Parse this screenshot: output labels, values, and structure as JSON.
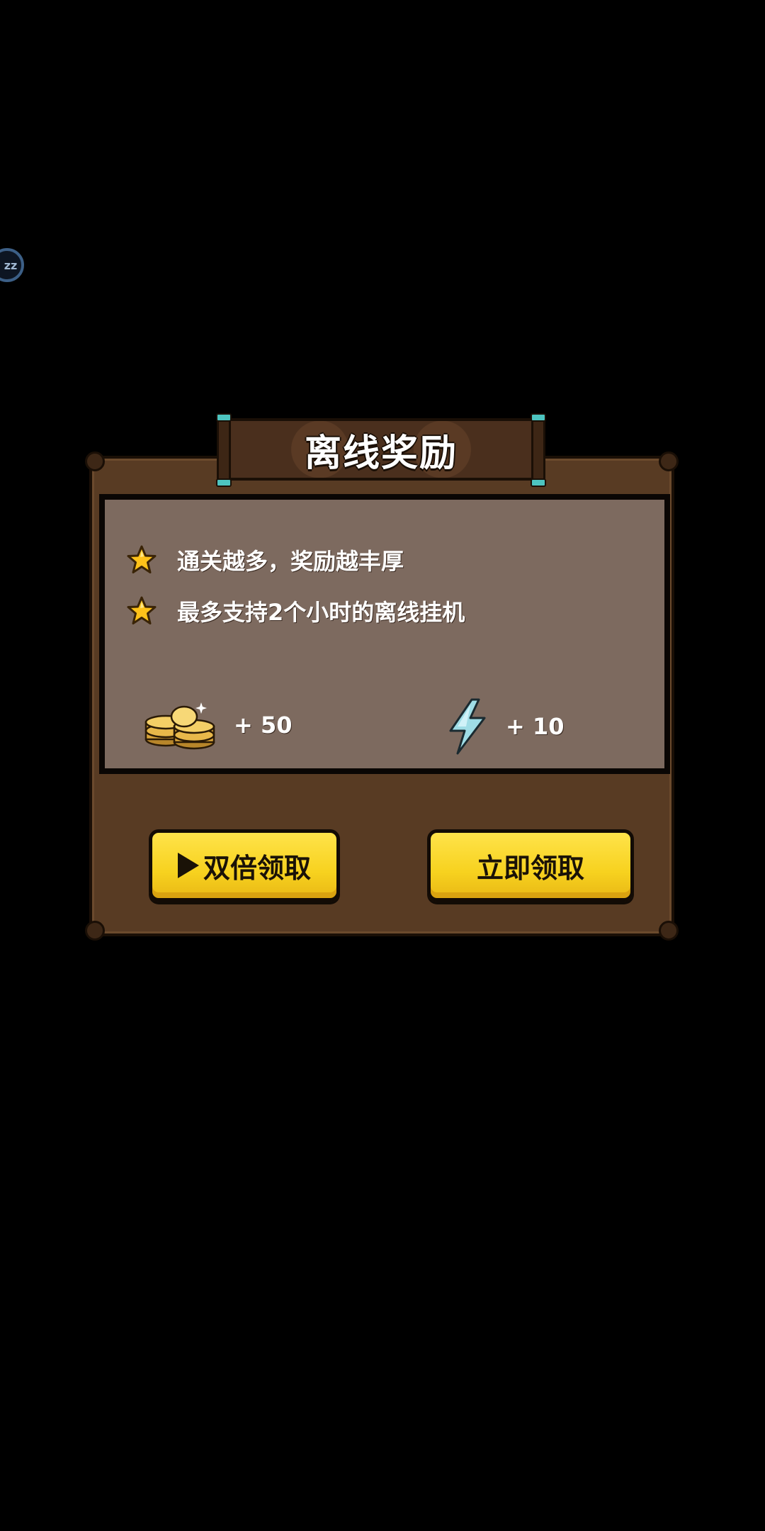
{
  "dialog": {
    "title": "离线奖励",
    "tips": [
      "通关越多，奖励越丰厚",
      "最多支持2个小时的离线挂机"
    ],
    "rewards": {
      "gold": {
        "amount": "+ 50",
        "icon": "gold-coins-icon"
      },
      "energy": {
        "amount": "+ 10",
        "icon": "lightning-icon"
      }
    },
    "buttons": {
      "double_label": "双倍领取",
      "claim_label": "立即领取"
    }
  },
  "floating_button": {
    "label": "zz"
  },
  "colors": {
    "panel": "#583b23",
    "info_box": "#7d6a5f",
    "button_yellow": "#f7d21f",
    "accent_teal": "#4dc4c0"
  }
}
